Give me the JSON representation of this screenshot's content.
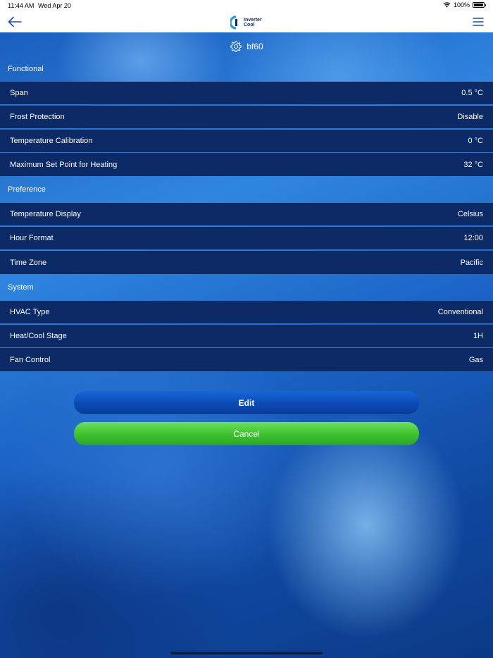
{
  "status_bar": {
    "time": "11:44 AM",
    "date": "Wed Apr 20",
    "battery": "100%"
  },
  "nav": {
    "logo_line1": "Inverter",
    "logo_line2": "Cool"
  },
  "device": {
    "name": "bf60",
    "icon": "gear-icon"
  },
  "sections": {
    "functional": {
      "title": "Functional",
      "rows": [
        {
          "label": "Span",
          "value": "0.5 °C"
        },
        {
          "label": "Frost Protection",
          "value": "Disable"
        },
        {
          "label": "Temperature Calibration",
          "value": "0 °C"
        },
        {
          "label": "Maximum Set Point for Heating",
          "value": "32 °C"
        }
      ]
    },
    "preference": {
      "title": "Preference",
      "rows": [
        {
          "label": "Temperature Display",
          "value": "Celsius"
        },
        {
          "label": "Hour Format",
          "value": "12:00"
        },
        {
          "label": "Time Zone",
          "value": "Pacific"
        }
      ]
    },
    "system": {
      "title": "System",
      "rows": [
        {
          "label": "HVAC Type",
          "value": "Conventional"
        },
        {
          "label": "Heat/Cool Stage",
          "value": "1H"
        },
        {
          "label": "Fan Control",
          "value": "Gas"
        }
      ]
    }
  },
  "buttons": {
    "edit": "Edit",
    "cancel": "Cancel"
  },
  "colors": {
    "row_background": "#0b2a66",
    "edit_button": "#0b4ab5",
    "cancel_button": "#3cc12f"
  }
}
